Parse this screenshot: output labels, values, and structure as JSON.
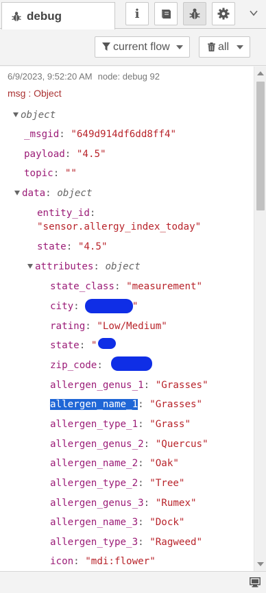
{
  "tab": {
    "label": "debug",
    "icon": "bug-icon"
  },
  "sidebar_buttons": [
    {
      "name": "info-icon",
      "active": false
    },
    {
      "name": "book-icon",
      "active": false
    },
    {
      "name": "bug-icon",
      "active": true
    },
    {
      "name": "gear-icon",
      "active": false
    }
  ],
  "filters": {
    "flow_label": "current flow",
    "clear_label": "all"
  },
  "message": {
    "timestamp": "6/9/2023, 9:52:20 AM",
    "node": "node: debug 92",
    "msg_label": "msg : Object",
    "rows": {
      "root": "object",
      "msgid_key": "_msgid",
      "msgid_val": "\"649d914df6dd8ff4\"",
      "payload_key": "payload",
      "payload_val": "\"4.5\"",
      "topic_key": "topic",
      "topic_val": "\"\"",
      "data_key": "data",
      "data_type": "object",
      "entity_id_key": "entity_id",
      "entity_id_val": "\"sensor.allergy_index_today\"",
      "state_key": "state",
      "state_val": "\"4.5\"",
      "attributes_key": "attributes",
      "attributes_type": "object",
      "state_class_key": "state_class",
      "state_class_val": "\"measurement\"",
      "city_key": "city",
      "rating_key": "rating",
      "rating_val": "\"Low/Medium\"",
      "attr_state_key": "state",
      "zip_code_key": "zip_code",
      "allergen_genus_1_key": "allergen_genus_1",
      "allergen_genus_1_val": "\"Grasses\"",
      "allergen_name_1_key": "allergen_name_1",
      "allergen_name_1_val": "\"Grasses\"",
      "allergen_type_1_key": "allergen_type_1",
      "allergen_type_1_val": "\"Grass\"",
      "allergen_genus_2_key": "allergen_genus_2",
      "allergen_genus_2_val": "\"Quercus\"",
      "allergen_name_2_key": "allergen_name_2",
      "allergen_name_2_val": "\"Oak\"",
      "allergen_type_2_key": "allergen_type_2",
      "allergen_type_2_val": "\"Tree\"",
      "allergen_genus_3_key": "allergen_genus_3",
      "allergen_genus_3_val": "\"Rumex\"",
      "allergen_name_3_key": "allergen_name_3",
      "allergen_name_3_val": "\"Dock\"",
      "allergen_type_3_key": "allergen_type_3",
      "allergen_type_3_val": "\"Ragweed\"",
      "icon_key": "icon",
      "icon_val": "\"mdi:flower\""
    }
  },
  "colors": {
    "key": "#9b1c77",
    "string": "#b8232a",
    "selection": "#1f66d6",
    "redaction": "#0f2ee6"
  },
  "footer_icon": "monitor-icon"
}
